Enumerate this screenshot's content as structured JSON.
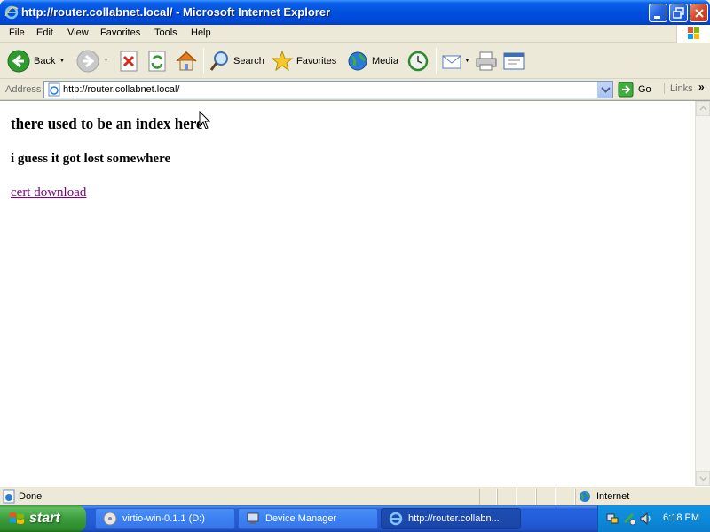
{
  "window": {
    "title": "http://router.collabnet.local/ - Microsoft Internet Explorer"
  },
  "menu": {
    "items": [
      "File",
      "Edit",
      "View",
      "Favorites",
      "Tools",
      "Help"
    ]
  },
  "toolbar": {
    "back": "Back",
    "search": "Search",
    "favorites": "Favorites",
    "media": "Media"
  },
  "address": {
    "label": "Address",
    "url": "http://router.collabnet.local/",
    "go": "Go",
    "links": "Links"
  },
  "page": {
    "heading": "there used to be an index here",
    "subheading": "i guess it got lost somewhere",
    "link": "cert download"
  },
  "status": {
    "text": "Done",
    "zone": "Internet"
  },
  "taskbar": {
    "start": "start",
    "tasks": [
      "virtio-win-0.1.1 (D:)",
      "Device Manager",
      "http://router.collabn..."
    ],
    "clock": "6:18 PM"
  },
  "colors": {
    "titlebar": "#0050e0",
    "visited_link": "#800080",
    "taskbar": "#245edb",
    "start_button": "#3c9d3c"
  }
}
